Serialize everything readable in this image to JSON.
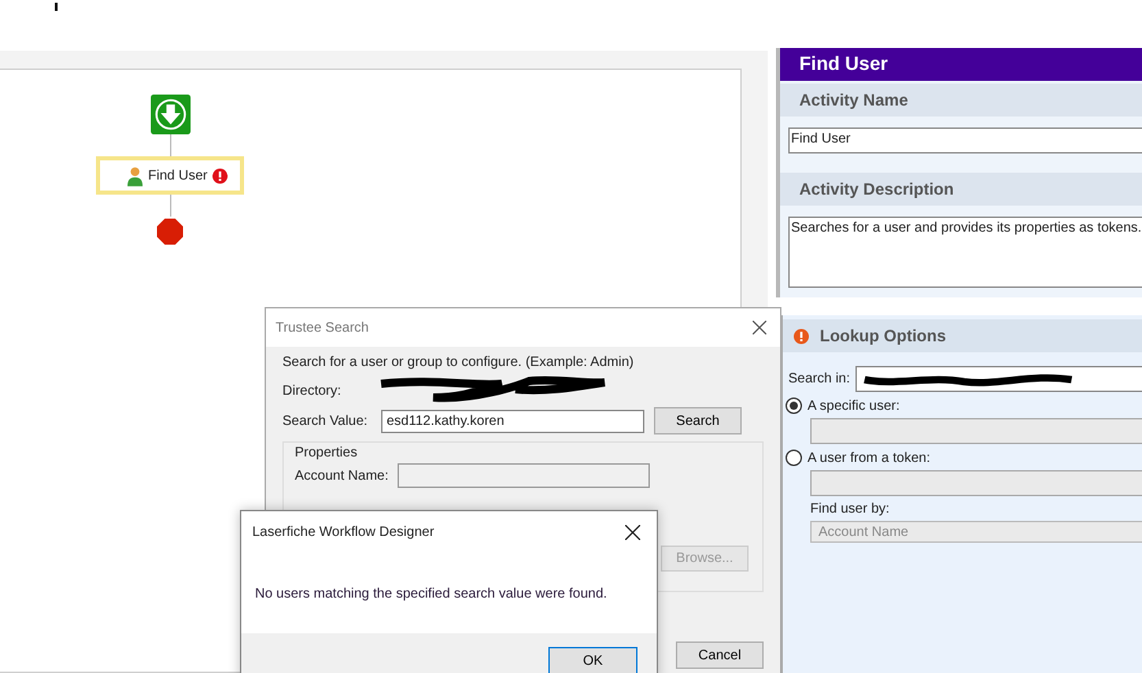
{
  "canvas": {
    "nodes": [
      {
        "kind": "start"
      },
      {
        "kind": "activity",
        "label": "Find User",
        "selected": true,
        "error": true
      },
      {
        "kind": "end"
      }
    ]
  },
  "properties": {
    "title": "Find User",
    "sections": [
      {
        "heading": "Activity Name",
        "kind": "text",
        "value": "Find User"
      },
      {
        "heading": "Activity Description",
        "kind": "textarea",
        "value": "Searches for a user and provides its properties as tokens."
      }
    ]
  },
  "lookup_options": {
    "heading": "Lookup Options",
    "warning": true,
    "search_in_label": "Search in:",
    "options": [
      {
        "label": "A specific user:",
        "selected": true
      },
      {
        "label": "A user from a token:",
        "selected": false
      }
    ],
    "find_by_label": "Find user by:",
    "find_by_value": "Account Name"
  },
  "trustee_dialog": {
    "title": "Trustee Search",
    "instruction": "Search for a user or group to configure. (Example: Admin)",
    "directory_label": "Directory:",
    "search_value_label": "Search Value:",
    "search_value": "esd112.kathy.koren",
    "search_button": "Search",
    "properties_heading": "Properties",
    "fields": [
      {
        "label": "Account Name:"
      }
    ],
    "browse_button": {
      "label": "Browse...",
      "disabled": true
    },
    "cancel_button": "Cancel"
  },
  "message_box": {
    "title": "Laserfiche Workflow Designer",
    "message": "No users matching the specified search value were found.",
    "ok_button": "OK"
  }
}
